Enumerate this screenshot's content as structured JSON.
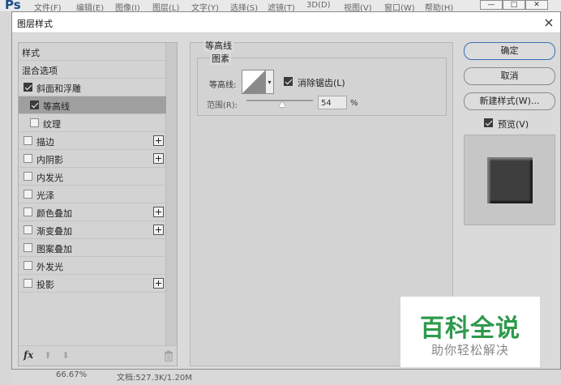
{
  "app": {
    "logo": "Ps",
    "menus": [
      "文件(F)",
      "编辑(E)",
      "图像(I)",
      "图层(L)",
      "文字(Y)",
      "选择(S)",
      "滤镜(T)",
      "3D(D)",
      "视图(V)",
      "窗口(W)",
      "帮助(H)"
    ],
    "status": {
      "zoom": "66.67%",
      "doc_info": "文档:527.3K/1.20M"
    }
  },
  "dialog": {
    "title": "图层样式",
    "close_glyph": "×",
    "styles_list": {
      "header_styles": "样式",
      "header_blending": "混合选项",
      "items": [
        {
          "label": "斜面和浮雕",
          "checked": true
        },
        {
          "label": "等高线",
          "checked": true,
          "sub": true,
          "selected": true
        },
        {
          "label": "纹理",
          "checked": false,
          "sub": true
        },
        {
          "label": "描边",
          "checked": false,
          "plus": true
        },
        {
          "label": "内阴影",
          "checked": false,
          "plus": true
        },
        {
          "label": "内发光",
          "checked": false
        },
        {
          "label": "光泽",
          "checked": false
        },
        {
          "label": "颜色叠加",
          "checked": false,
          "plus": true
        },
        {
          "label": "渐变叠加",
          "checked": false,
          "plus": true
        },
        {
          "label": "图案叠加",
          "checked": false
        },
        {
          "label": "外发光",
          "checked": false
        },
        {
          "label": "投影",
          "checked": false,
          "plus": true
        }
      ],
      "footer": {
        "fx": "fx",
        "up_glyph": "⬆",
        "down_glyph": "⬇"
      }
    },
    "contour_panel": {
      "section_title": "等高线",
      "group_title": "图素",
      "contour_label": "等高线:",
      "dropdown_glyph": "▾",
      "anti_alias_label": "消除锯齿(L)",
      "anti_alias_checked": true,
      "range_label": "范围(R):",
      "range_value": "54",
      "range_percent": 54,
      "range_unit": "%"
    },
    "buttons": {
      "ok": "确定",
      "cancel": "取消",
      "new_style": "新建样式(W)...",
      "preview_label": "预览(V)",
      "preview_checked": true
    }
  },
  "watermark": {
    "title": "百科全说",
    "subtitle": "助你轻松解决"
  }
}
